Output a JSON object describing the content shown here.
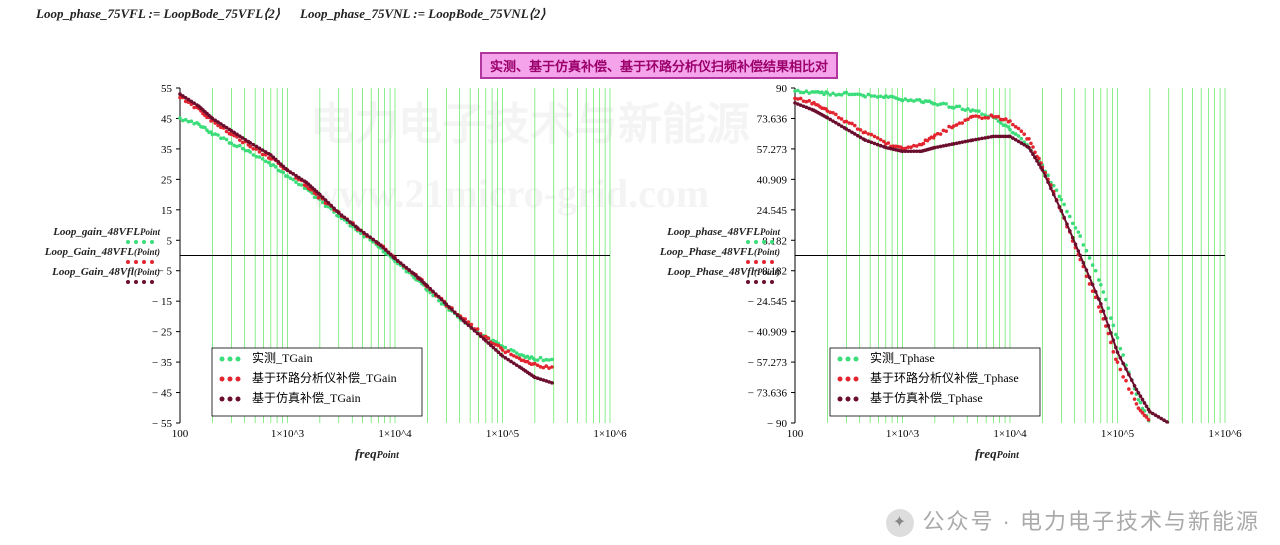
{
  "top_vars": {
    "left": "Loop_phase_75VFL := LoopBode_75VFL⟨2⟩",
    "right": "Loop_phase_75VNL := LoopBode_75VNL⟨2⟩"
  },
  "magenta_title": "实测、基于仿真补偿、基于环路分析仪扫频补偿结果相比对",
  "watermark_cn": "电力电子技术与新能源",
  "watermark_url": "www.21micro-grid.com",
  "footer": "公众号 · 电力电子技术与新能源",
  "xlabel_main": "freq",
  "xlabel_sub": "Point",
  "side_labels_gain": [
    {
      "main": "Loop_gain_48VFL",
      "sub": "Point",
      "color": "#3bdc7a"
    },
    {
      "main": "Loop_Gain_48VFL",
      "sub": "(Point)",
      "color": "#e2252f"
    },
    {
      "main": "Loop_Gain_48Vfl",
      "sub": "(Point)",
      "color": "#6b0d2c"
    }
  ],
  "side_labels_phase": [
    {
      "main": "Loop_phase_48VFL",
      "sub": "Point",
      "color": "#3bdc7a"
    },
    {
      "main": "Loop_Phase_48VFL",
      "sub": "(Point)",
      "color": "#e2252f"
    },
    {
      "main": "Loop_Phase_48Vfl",
      "sub": "(Point)",
      "color": "#6b0d2c"
    }
  ],
  "legend_gain": {
    "items": [
      {
        "label": "实测_TGain",
        "color": "#3bdc7a"
      },
      {
        "label": "基于环路分析仪补偿_TGain",
        "color": "#e2252f"
      },
      {
        "label": "基于仿真补偿_TGain",
        "color": "#6b0d2c"
      }
    ]
  },
  "legend_phase": {
    "items": [
      {
        "label": "实测_Tphase",
        "color": "#3bdc7a"
      },
      {
        "label": "基于环路分析仪补偿_Tphase",
        "color": "#e2252f"
      },
      {
        "label": "基于仿真补偿_Tphase",
        "color": "#6b0d2c"
      }
    ]
  },
  "chart_data": [
    {
      "type": "line",
      "id": "gain",
      "title": "",
      "xlabel": "freq_Point",
      "ylabel": "",
      "xscale": "log",
      "xlim": [
        100,
        1000000
      ],
      "ylim": [
        -55,
        55
      ],
      "yticks": [
        -55,
        -45,
        -35,
        -25,
        -15,
        -5,
        5,
        15,
        25,
        35,
        45,
        55
      ],
      "xticks": [
        100,
        1000,
        10000,
        100000,
        1000000
      ],
      "xtick_labels": [
        "100",
        "1×10^3",
        "1×10^4",
        "1×10^5",
        "1×10^6"
      ],
      "series": [
        {
          "name": "实测_TGain",
          "color": "#3bdc7a",
          "style": "dots",
          "x": [
            100,
            150,
            200,
            300,
            450,
            700,
            1000,
            1500,
            2000,
            3000,
            4500,
            7000,
            10000,
            15000,
            20000,
            30000,
            45000,
            70000,
            100000,
            150000,
            200000,
            300000
          ],
          "y": [
            45,
            43,
            40,
            37,
            34,
            30,
            26,
            22,
            18,
            13,
            8,
            3,
            -2,
            -7,
            -11,
            -17,
            -22,
            -27,
            -30,
            -33,
            -34,
            -34
          ]
        },
        {
          "name": "基于环路分析仪补偿_TGain",
          "color": "#e2252f",
          "style": "dots",
          "x": [
            100,
            150,
            200,
            300,
            450,
            700,
            1000,
            1500,
            2000,
            3000,
            4500,
            7000,
            10000,
            15000,
            20000,
            30000,
            45000,
            70000,
            100000,
            150000,
            200000,
            300000
          ],
          "y": [
            52,
            48,
            44,
            40,
            36,
            32,
            28,
            23,
            19,
            14,
            9,
            4,
            -1,
            -6,
            -10,
            -16,
            -21,
            -27,
            -31,
            -34,
            -36,
            -37
          ]
        },
        {
          "name": "基于仿真补偿_TGain",
          "color": "#6b0d2c",
          "style": "line",
          "x": [
            100,
            150,
            200,
            300,
            450,
            700,
            1000,
            1500,
            2000,
            3000,
            4500,
            7000,
            10000,
            15000,
            20000,
            30000,
            45000,
            70000,
            100000,
            150000,
            200000,
            300000
          ],
          "y": [
            53,
            49,
            45,
            41,
            37,
            33,
            28,
            24,
            20,
            14,
            9,
            4,
            -1,
            -6,
            -10,
            -16,
            -22,
            -28,
            -33,
            -37,
            -40,
            -42
          ]
        }
      ]
    },
    {
      "type": "line",
      "id": "phase",
      "title": "",
      "xlabel": "freq_Point",
      "ylabel": "",
      "xscale": "log",
      "xlim": [
        100,
        1000000
      ],
      "ylim": [
        -90,
        90
      ],
      "yticks": [
        -90,
        -73.636,
        -57.273,
        -40.909,
        -24.545,
        -8.182,
        8.182,
        24.545,
        40.909,
        57.273,
        73.636,
        90
      ],
      "xticks": [
        100,
        1000,
        10000,
        100000,
        1000000
      ],
      "xtick_labels": [
        "100",
        "1×10^3",
        "1×10^4",
        "1×10^5",
        "1×10^6"
      ],
      "series": [
        {
          "name": "实测_Tphase",
          "color": "#3bdc7a",
          "style": "dots",
          "x": [
            100,
            150,
            200,
            300,
            450,
            700,
            1000,
            1500,
            2000,
            3000,
            4500,
            7000,
            10000,
            15000,
            20000,
            30000,
            45000,
            70000,
            100000,
            150000,
            200000
          ],
          "y": [
            88,
            88,
            87,
            87,
            86,
            85,
            84,
            83,
            82,
            80,
            78,
            74,
            68,
            58,
            48,
            30,
            10,
            -15,
            -45,
            -75,
            -90
          ]
        },
        {
          "name": "基于环路分析仪补偿_Tphase",
          "color": "#e2252f",
          "style": "dots",
          "x": [
            100,
            150,
            200,
            300,
            450,
            700,
            1000,
            1500,
            2000,
            3000,
            4500,
            7000,
            10000,
            15000,
            20000,
            30000,
            45000,
            70000,
            100000,
            150000,
            200000
          ],
          "y": [
            85,
            82,
            78,
            72,
            66,
            60,
            58,
            60,
            64,
            70,
            74,
            75,
            72,
            62,
            48,
            24,
            -2,
            -30,
            -58,
            -80,
            -90
          ]
        },
        {
          "name": "基于仿真补偿_Tphase",
          "color": "#6b0d2c",
          "style": "line",
          "x": [
            100,
            150,
            200,
            300,
            450,
            700,
            1000,
            1500,
            2000,
            3000,
            4500,
            7000,
            10000,
            15000,
            20000,
            30000,
            45000,
            70000,
            100000,
            150000,
            200000,
            300000
          ],
          "y": [
            82,
            78,
            74,
            68,
            62,
            58,
            56,
            56,
            58,
            60,
            62,
            64,
            64,
            58,
            46,
            24,
            0,
            -26,
            -52,
            -72,
            -84,
            -90
          ]
        }
      ]
    }
  ]
}
